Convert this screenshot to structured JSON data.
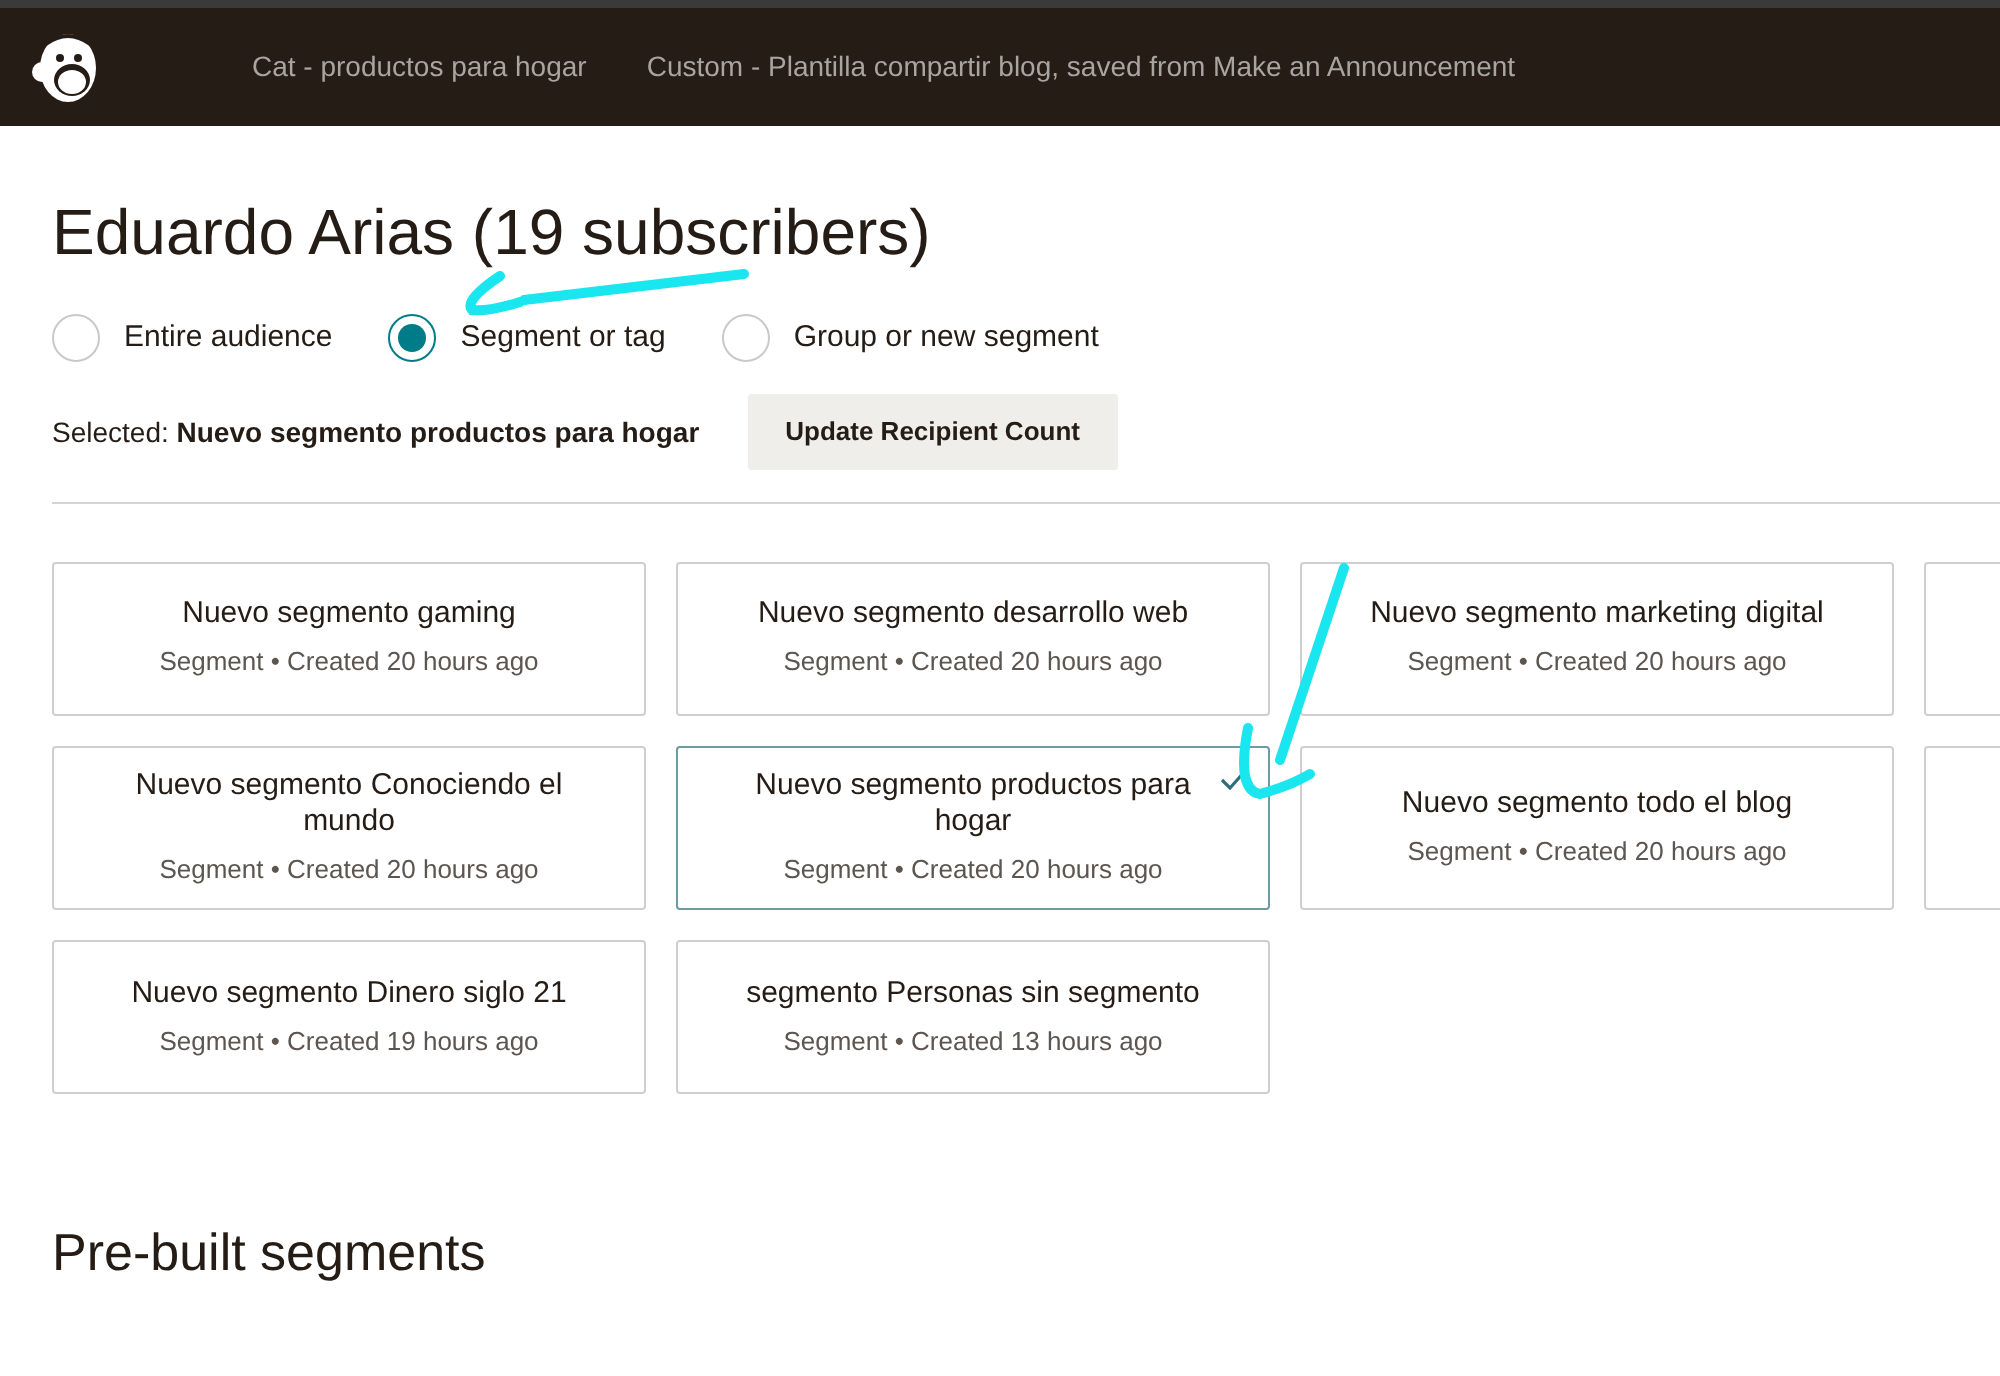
{
  "header": {
    "breadcrumbs": [
      "Cat - productos para hogar",
      "Custom - Plantilla compartir blog, saved from Make an Announcement"
    ]
  },
  "title": "Eduardo Arias (19 subscribers)",
  "recipient_options": [
    {
      "label": "Entire audience",
      "selected": false
    },
    {
      "label": "Segment or tag",
      "selected": true
    },
    {
      "label": "Group or new segment",
      "selected": false
    }
  ],
  "selection": {
    "label": "Selected:",
    "value": "Nuevo segmento productos para hogar",
    "button": "Update Recipient Count"
  },
  "segments": [
    {
      "kind": "segment",
      "title": "Nuevo segmento gaming",
      "meta": "Segment • Created 20 hours ago",
      "selected": false
    },
    {
      "kind": "segment",
      "title": "Nuevo segmento desarrollo web",
      "meta": "Segment • Created 20 hours ago",
      "selected": false
    },
    {
      "kind": "segment",
      "title": "Nuevo segmento marketing digital",
      "meta": "Segment • Created 20 hours ago",
      "selected": false
    },
    {
      "kind": "clipped"
    },
    {
      "kind": "segment",
      "title": "Nuevo segmento Conociendo el mundo",
      "meta": "Segment • Created 20 hours ago",
      "selected": false
    },
    {
      "kind": "segment",
      "title": "Nuevo segmento productos para hogar",
      "meta": "Segment • Created 20 hours ago",
      "selected": true
    },
    {
      "kind": "segment",
      "title": "Nuevo segmento todo el blog",
      "meta": "Segment • Created 20 hours ago",
      "selected": false
    },
    {
      "kind": "clipped"
    },
    {
      "kind": "segment",
      "title": "Nuevo segmento Dinero siglo 21",
      "meta": "Segment • Created 19 hours ago",
      "selected": false
    },
    {
      "kind": "segment",
      "title": "segmento Personas sin segmento",
      "meta": "Segment • Created 13 hours ago",
      "selected": false
    }
  ],
  "prebuilt": {
    "title": "Pre-built segments"
  }
}
